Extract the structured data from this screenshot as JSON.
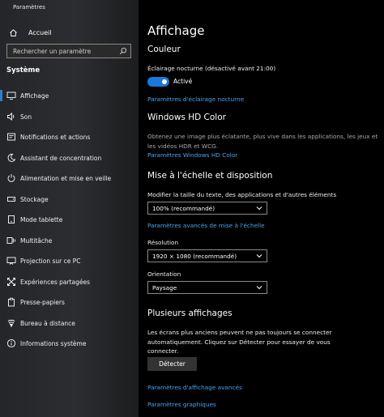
{
  "window": {
    "title": "Paramètres"
  },
  "sidebar": {
    "home_label": "Accueil",
    "search_placeholder": "Rechercher un paramètre",
    "section_title": "Système",
    "items": [
      {
        "label": "Affichage",
        "icon": "monitor-icon",
        "active": true
      },
      {
        "label": "Son",
        "icon": "speaker-icon"
      },
      {
        "label": "Notifications et actions",
        "icon": "notification-icon"
      },
      {
        "label": "Assistant de concentration",
        "icon": "moon-icon"
      },
      {
        "label": "Alimentation et mise en veille",
        "icon": "power-icon"
      },
      {
        "label": "Stockage",
        "icon": "storage-icon"
      },
      {
        "label": "Mode tablette",
        "icon": "tablet-icon"
      },
      {
        "label": "Multitâche",
        "icon": "multitask-icon"
      },
      {
        "label": "Projection sur ce PC",
        "icon": "projection-icon"
      },
      {
        "label": "Expériences partagées",
        "icon": "shared-icon"
      },
      {
        "label": "Presse-papiers",
        "icon": "clipboard-icon"
      },
      {
        "label": "Bureau à distance",
        "icon": "remote-desktop-icon"
      },
      {
        "label": "Informations système",
        "icon": "info-icon"
      }
    ]
  },
  "main": {
    "title": "Affichage",
    "color": {
      "heading": "Couleur",
      "night_light_label": "Éclairage nocturne (désactivé avant 21:00)",
      "toggle_state": "Activé",
      "night_light_link": "Paramètres d'éclairage nocturne"
    },
    "hd_color": {
      "heading": "Windows HD Color",
      "description": "Obtenez une image plus éclatante, plus vive dans les applications, les jeux et les vidéos HDR et WCG.",
      "link": "Paramètres Windows HD Color"
    },
    "scale": {
      "heading": "Mise à l'échelle et disposition",
      "text_size_label": "Modifier la taille du texte, des applications et d'autres éléments",
      "text_size_value": "100% (recommandé)",
      "advanced_link": "Paramètres avancés de mise à l'échelle",
      "resolution_label": "Résolution",
      "resolution_value": "1920 × 1080 (recommandé)",
      "orientation_label": "Orientation",
      "orientation_value": "Paysage"
    },
    "multi": {
      "heading": "Plusieurs affichages",
      "description": "Les écrans plus anciens peuvent ne pas toujours se connecter automatiquement. Cliquez sur Détecter pour essayer de vous connecter.",
      "detect_button": "Détecter",
      "advanced_link": "Paramètres d'affichage avancés",
      "graphics_link": "Paramètres graphiques"
    }
  },
  "colors": {
    "accent": "#1a78d8",
    "link": "#4aa3ef",
    "background": "#000000"
  }
}
